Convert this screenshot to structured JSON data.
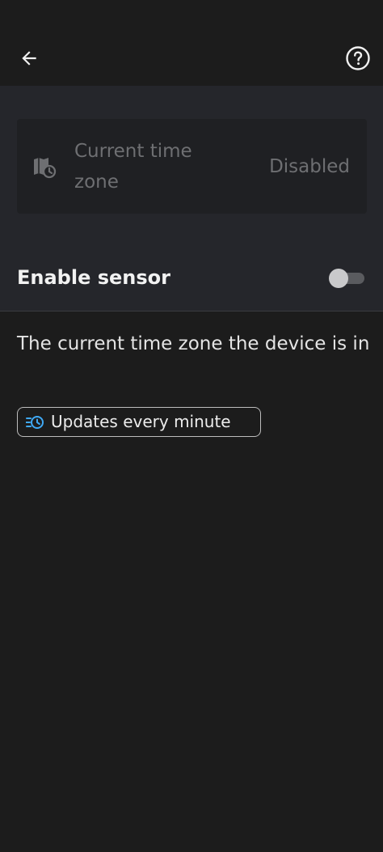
{
  "header": {
    "back_icon": "arrow-left-icon",
    "help_icon": "help-circle-icon"
  },
  "entity": {
    "icon": "map-clock-icon",
    "name": "Current time zone",
    "state": "Disabled"
  },
  "sensor": {
    "enable_label": "Enable sensor",
    "enabled": false
  },
  "description": "The current time zone the device is in",
  "update_chip": {
    "icon": "update-clock-icon",
    "label": "Updates every minute",
    "icon_color": "#3fa9f5"
  },
  "colors": {
    "background": "#1c1c1c",
    "panel": "#25262b",
    "card": "#1f2023"
  }
}
